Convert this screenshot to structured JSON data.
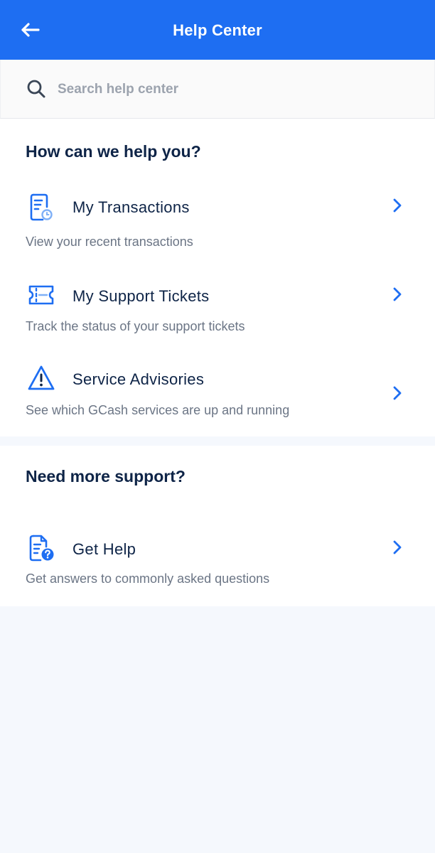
{
  "header": {
    "title": "Help Center",
    "back_icon": "arrow-left-icon"
  },
  "search": {
    "placeholder": "Search help center",
    "value": ""
  },
  "help_section": {
    "heading": "How can we help you?",
    "items": [
      {
        "title": "My Transactions",
        "subtitle": "View your recent transactions",
        "icon": "transactions-receipt-icon"
      },
      {
        "title": "My Support Tickets",
        "subtitle": "Track the status of your support tickets",
        "icon": "ticket-icon"
      },
      {
        "title": "Service Advisories",
        "subtitle": "See which GCash services are up and running",
        "icon": "warning-icon"
      }
    ]
  },
  "support_section": {
    "heading": "Need more support?",
    "items": [
      {
        "title": "Get Help",
        "subtitle": "Get answers to commonly asked questions",
        "icon": "help-document-icon"
      }
    ]
  },
  "colors": {
    "brand_blue": "#1E6EF2",
    "heading_navy": "#0E2447",
    "subtitle_gray": "#6B7585",
    "background": "#F5F8FD"
  }
}
